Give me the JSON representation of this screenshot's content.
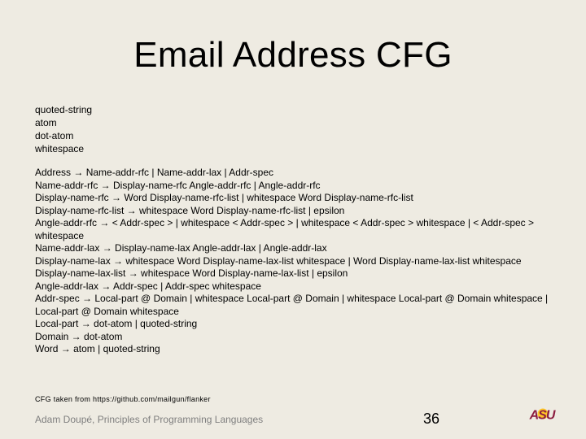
{
  "slide": {
    "title": "Email Address CFG",
    "terminals": [
      "quoted-string",
      "atom",
      "dot-atom",
      "whitespace"
    ],
    "rules": [
      "Address → Name-addr-rfc | Name-addr-lax | Addr-spec",
      "Name-addr-rfc → Display-name-rfc Angle-addr-rfc | Angle-addr-rfc",
      "Display-name-rfc → Word Display-name-rfc-list | whitespace Word Display-name-rfc-list",
      "Display-name-rfc-list → whitespace Word Display-name-rfc-list | epsilon",
      "Angle-addr-rfc → < Addr-spec > | whitespace < Addr-spec > | whitespace < Addr-spec > whitespace | < Addr-spec > whitespace",
      "Name-addr-lax → Display-name-lax Angle-addr-lax | Angle-addr-lax",
      "Display-name-lax → whitespace Word Display-name-lax-list whitespace | Word Display-name-lax-list whitespace",
      "Display-name-lax-list → whitespace Word Display-name-lax-list | epsilon",
      "Angle-addr-lax → Addr-spec | Addr-spec whitespace",
      "Addr-spec → Local-part @ Domain | whitespace Local-part @ Domain | whitespace Local-part @ Domain whitespace | Local-part @ Domain whitespace",
      "Local-part → dot-atom | quoted-string",
      "Domain → dot-atom",
      "Word → atom | quoted-string"
    ],
    "footnote": "CFG taken from https://github.com/mailgun/flanker"
  },
  "footer": {
    "author": "Adam Doupé, Principles of Programming Languages",
    "page_number": "36",
    "logo_text": "ASU"
  },
  "colors": {
    "background": "#eeebe2",
    "logo_maroon": "#8c1d40",
    "logo_gold": "#ffc627",
    "author_gray": "#7f7f7f"
  }
}
